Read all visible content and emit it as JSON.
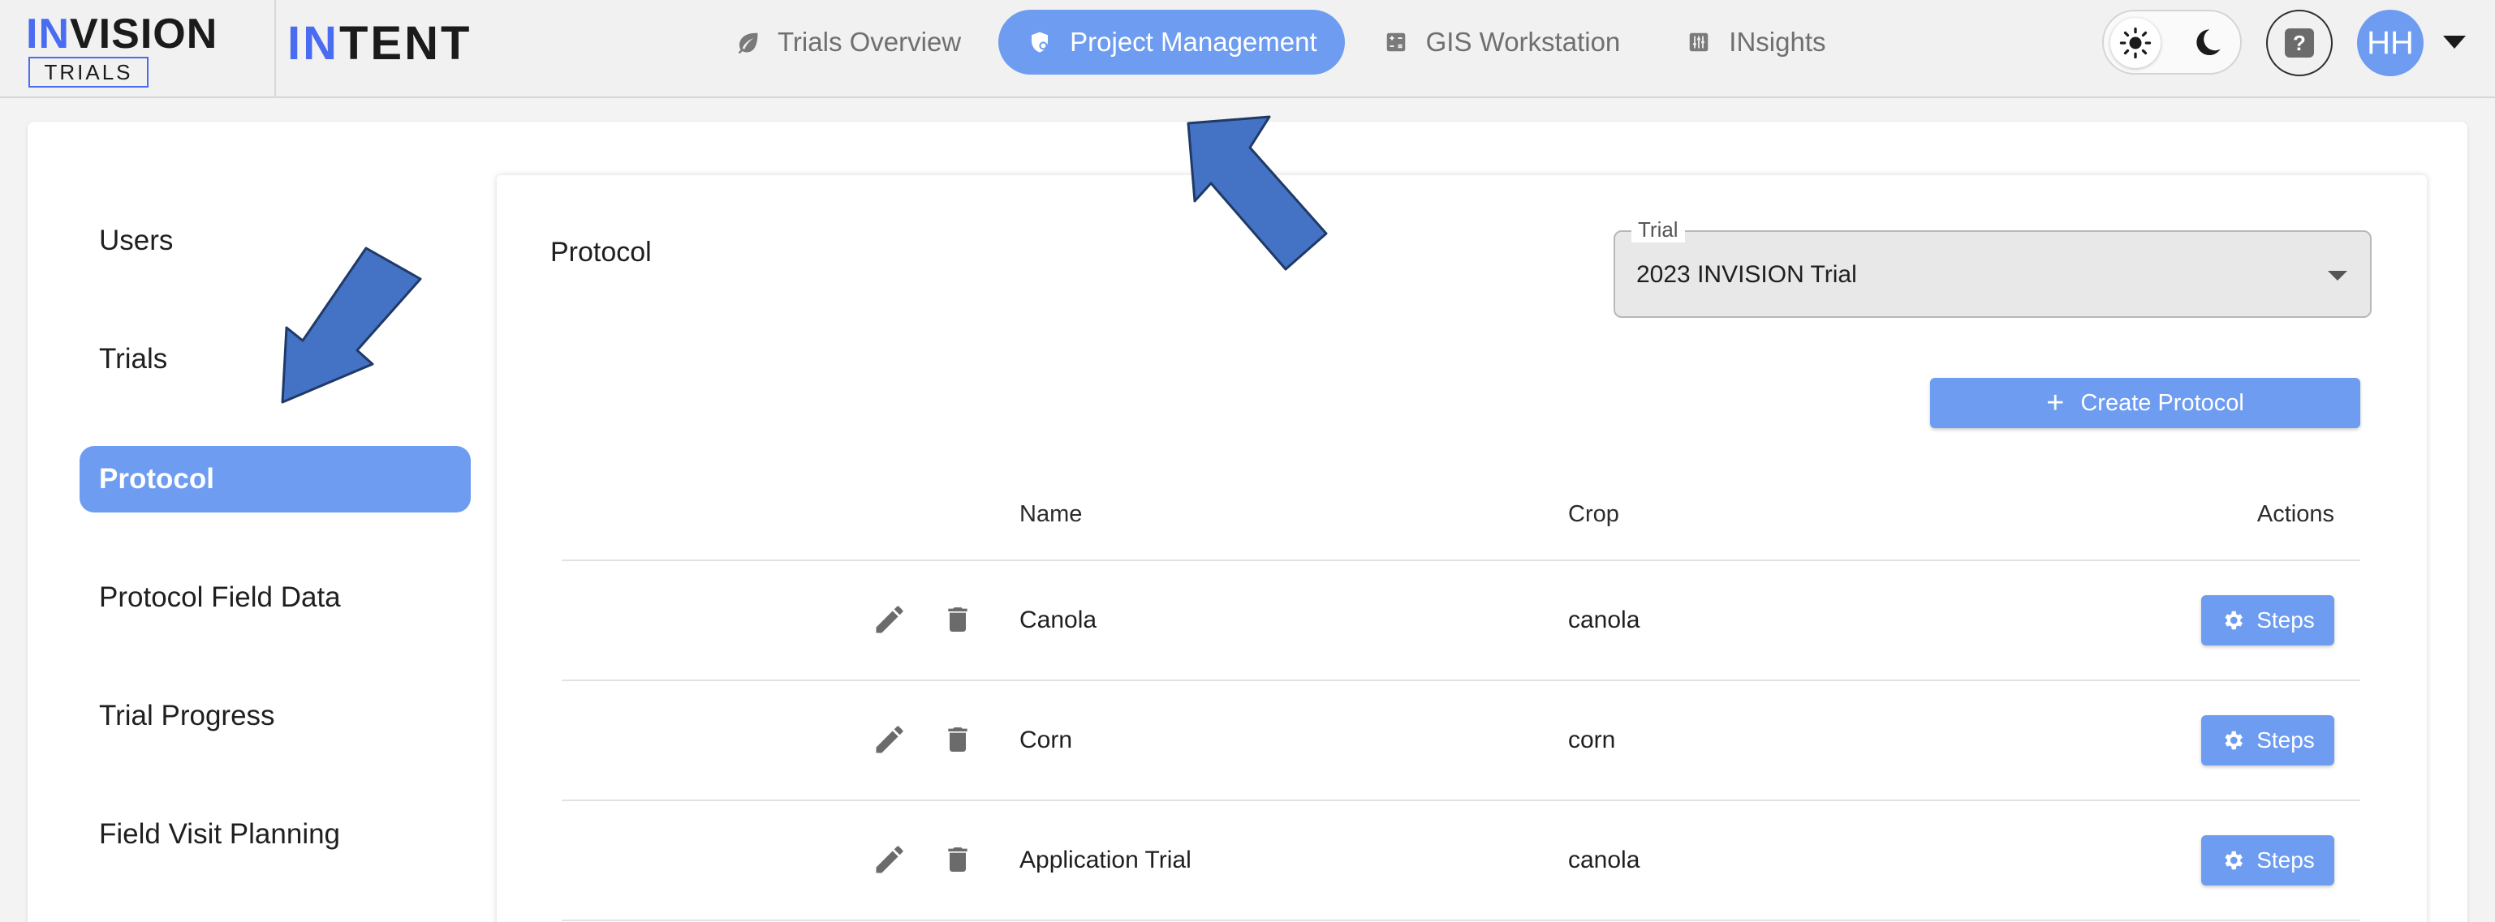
{
  "branding": {
    "invision_word_part1": "IN",
    "invision_word_part2": "VISION",
    "trials_badge": "TRIALS",
    "intent_part1": "IN",
    "intent_part2": "TENT"
  },
  "nav": {
    "items": [
      {
        "label": "Trials Overview",
        "icon": "leaf-icon",
        "active": false
      },
      {
        "label": "Project Management",
        "icon": "shield-icon",
        "active": true
      },
      {
        "label": "GIS Workstation",
        "icon": "calculator-icon",
        "active": false
      },
      {
        "label": "INsights",
        "icon": "sliders-icon",
        "active": false
      }
    ]
  },
  "header": {
    "help_label": "?",
    "avatar_initials": "HH"
  },
  "sidebar": {
    "items": [
      {
        "label": "Users",
        "active": false
      },
      {
        "label": "Trials",
        "active": false
      },
      {
        "label": "Protocol",
        "active": true
      },
      {
        "label": "Protocol Field Data",
        "active": false
      },
      {
        "label": "Trial Progress",
        "active": false
      },
      {
        "label": "Field Visit Planning",
        "active": false
      }
    ]
  },
  "content": {
    "title": "Protocol",
    "trial_select": {
      "label": "Trial",
      "value": "2023 INVISION Trial"
    },
    "create_label": "Create Protocol",
    "table": {
      "headers": {
        "name": "Name",
        "crop": "Crop",
        "actions": "Actions"
      },
      "rows": [
        {
          "name": "Canola",
          "crop": "canola",
          "action": "Steps"
        },
        {
          "name": "Corn",
          "crop": "corn",
          "action": "Steps"
        },
        {
          "name": "Application Trial",
          "crop": "canola",
          "action": "Steps"
        }
      ]
    }
  },
  "colors": {
    "accent": "#6d9cf0",
    "brand_blue": "#4a6cf0",
    "arrow_fill": "#4472c4",
    "arrow_stroke": "#1f3a66"
  }
}
